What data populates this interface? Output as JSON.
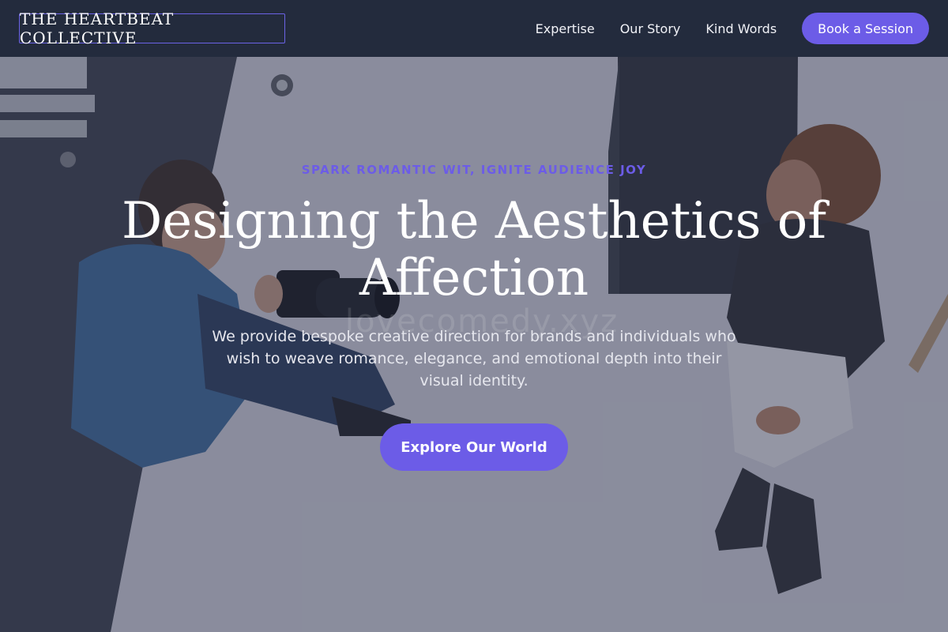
{
  "header": {
    "logo_text": "THE HEARTBEAT COLLECTIVE",
    "nav": [
      {
        "label": "Expertise"
      },
      {
        "label": "Our Story"
      },
      {
        "label": "Kind Words"
      }
    ],
    "cta_label": "Book a Session"
  },
  "hero": {
    "eyebrow": "SPARK ROMANTIC WIT, IGNITE AUDIENCE JOY",
    "headline": "Designing the Aesthetics of Affection",
    "subtext": "We provide bespoke creative direction for brands and individuals who wish to weave romance, elegance, and emotional depth into their visual identity.",
    "cta_label": "Explore Our World",
    "watermark": "lovecomedy.xyz"
  },
  "colors": {
    "header_bg": "#232b3d",
    "accent": "#6c5ce7",
    "text_light": "#ffffff"
  }
}
